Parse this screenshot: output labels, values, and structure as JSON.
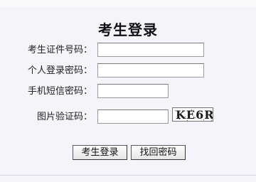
{
  "page": {
    "title": "考生登录"
  },
  "form": {
    "id_label": "考生证件号码：",
    "id_value": "",
    "password_label": "个人登录密码：",
    "password_value": "",
    "sms_label": "手机短信密码：",
    "sms_value": "",
    "captcha_label": "图片验证码：",
    "captcha_value": "",
    "captcha_image_text": "KE6R"
  },
  "buttons": {
    "login_label": "考生登录",
    "recover_label": "找回密码"
  }
}
